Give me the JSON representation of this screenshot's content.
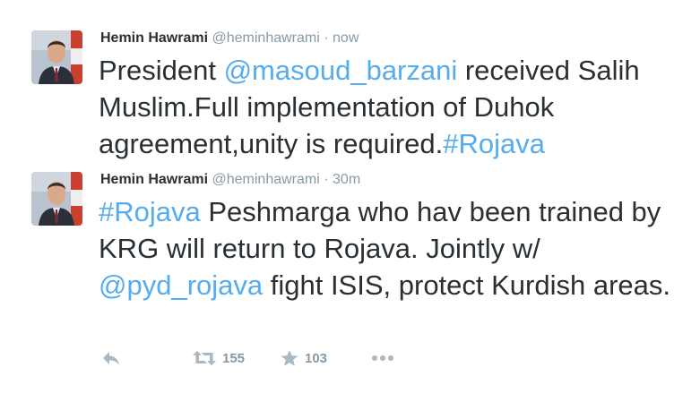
{
  "tweets": [
    {
      "name": "Hemin Hawrami",
      "handle": "@heminhawrami",
      "separator": "·",
      "time": "now",
      "text_parts": [
        "President ",
        "@masoud_barzani",
        " received Salih Muslim.Full implementation of Duhok agreement,unity is required.",
        "#Rojava"
      ]
    },
    {
      "name": "Hemin Hawrami",
      "handle": "@heminhawrami",
      "separator": "·",
      "time": "30m",
      "text_parts": [
        "#Rojava",
        " Peshmarga who hav been trained by KRG will return to Rojava. Jointly w/ ",
        "@pyd_rojava",
        " fight ISIS, protect Kurdish areas."
      ],
      "actions": {
        "reply_icon": "reply-icon",
        "retweet_icon": "retweet-icon",
        "retweet_count": "155",
        "favorite_icon": "star-icon",
        "favorite_count": "103",
        "more_icon": "more-icon"
      }
    }
  ],
  "colors": {
    "link": "#55acee",
    "text": "#292f33",
    "muted": "#8899a6",
    "icon": "#aab8c2"
  }
}
